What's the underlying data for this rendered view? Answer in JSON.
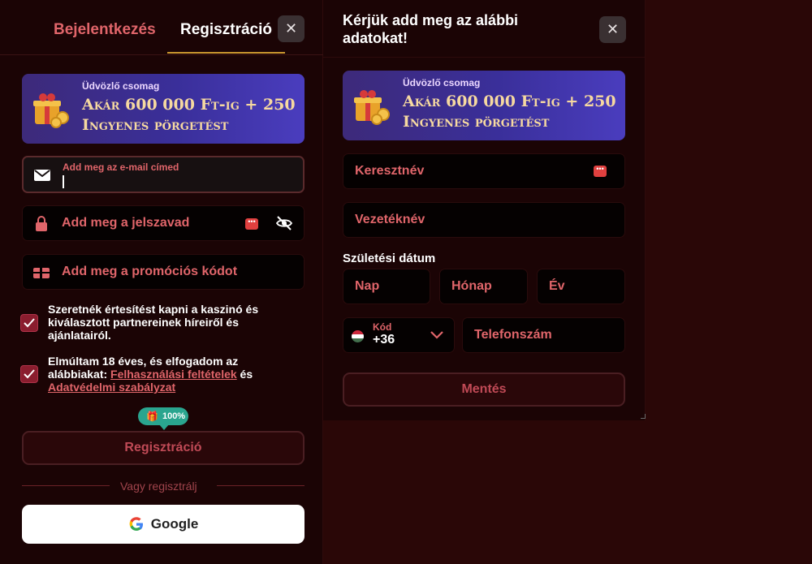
{
  "left_panel": {
    "tabs": [
      {
        "label": "Bejelentkezés"
      },
      {
        "label": "Regisztráció"
      }
    ],
    "close_icon": "close-icon",
    "banner": {
      "small": "Üdvözlő csomag",
      "line1": "Akár 600 000 Ft-ig + 250",
      "line2": "Ingyenes pörgetést"
    },
    "email_field": {
      "placeholder": "Add meg az e-mail címed",
      "icon": "mail-icon"
    },
    "password_field": {
      "placeholder": "Add meg a jelszavad",
      "icon": "lock-icon"
    },
    "promo_field": {
      "placeholder": "Add meg a promóciós kódot",
      "icon": "gift-card-icon"
    },
    "consent_marketing": "Szeretnék értesítést kapni a kaszinó és kiválasztott partnereinek híreiről és ajánlatairól.",
    "consent_age": {
      "prefix": "Elmúltam 18 éves, és elfogadom az alábbiakat: ",
      "terms_link": "Felhasználási feltételek",
      "connector": " és",
      "privacy_link": "Adatvédelmi szabályzat"
    },
    "progress_badge": "100%",
    "register_button": "Regisztráció",
    "or_text": "Vagy regisztrálj",
    "google_button": "Google"
  },
  "right_panel": {
    "title": "Kérjük add meg az alábbi adatokat!",
    "banner": {
      "small": "Üdvözlő csomag",
      "line1": "Akár 600 000 Ft-ig + 250",
      "line2": "Ingyenes pörgetést"
    },
    "first_name": "Keresztnév",
    "last_name": "Vezetéknév",
    "dob_label": "Születési dátum",
    "dob": {
      "day": "Nap",
      "month": "Hónap",
      "year": "Év"
    },
    "phone_code_label": "Kód",
    "phone_code_value": "+36",
    "phone_placeholder": "Telefonszám",
    "save_button": "Mentés"
  },
  "colors": {
    "accent": "#e0656a",
    "background": "#1b0405",
    "badge": "#2aa58f"
  }
}
